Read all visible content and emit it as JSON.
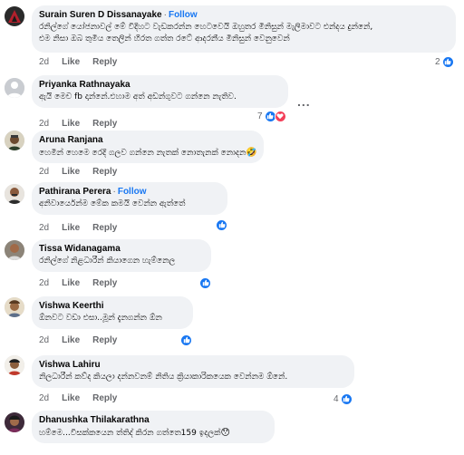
{
  "comments": [
    {
      "author": "Surain Suren D Dissanayake",
      "follow": "Follow",
      "lines": [
        "රනිල්ගේ යෝජනාවල් මේ විදිහට වැඩකරන්න හෙටවෙයි ඔහුතර මිනිසුන් මැලිමාවට එන්දය දුන්නේ,",
        "එම නිසා ඔබ තුමිය තෙලින් හිරත ගත්ත රටේ ආදරනීය මිනිසුන් වෙනුවෙන්"
      ],
      "time": "2d",
      "like": "Like",
      "reply": "Reply",
      "reaction_count": "2"
    },
    {
      "author": "Priyanka Rathnayaka",
      "lines": [
        "ඇයි මෙච fb දාන්නේ.එහාම අත් අඩන්ගුවට ගන්නෙ නැතිව."
      ],
      "time": "2d",
      "like": "Like",
      "reply": "Reply",
      "reaction_count": "7",
      "more": "..."
    },
    {
      "author": "Aruna Ranjana",
      "lines": [
        "හෙමින් හෙමෙ රෙදි ගලව ගන්නෙ නැතක් නොතැනක් නොදන"
      ],
      "emoji": "🤣",
      "time": "2d",
      "like": "Like",
      "reply": "Reply"
    },
    {
      "author": "Pathirana Perera",
      "follow": "Follow",
      "lines": [
        "අනිවාර්යෙන්ම මේක කමයි වෙන්න ඇත්තේ"
      ],
      "time": "2d",
      "like": "Like",
      "reply": "Reply"
    },
    {
      "author": "Tissa Widanagama",
      "lines": [
        "රනිල්ගේ නිළධාරීන් කියාගෙන හැම්නෙල"
      ],
      "time": "2d",
      "like": "Like",
      "reply": "Reply"
    },
    {
      "author": "Vishwa Keerthi",
      "lines": [
        "ඕනවට වඩා එසා..මූන් දැනගන්න ඕන"
      ],
      "time": "2d",
      "like": "Like",
      "reply": "Reply"
    },
    {
      "author": "Vishwa Lahiru",
      "lines": [
        "නිලධාරීන් කව්ද කියලා දන්නවනම් නිතිය ක්‍රියාකාරිකයෙක වෙන්නම ඕනේ."
      ],
      "time": "2d",
      "like": "Like",
      "reply": "Reply",
      "reaction_count": "4"
    },
    {
      "author": "Dhanushka Thilakarathna",
      "lines": [
        "හම්මෙ...විසක්කයෙන ත්තිද් කිරන ගත්තෙ159 ඉදලක්"
      ],
      "emoji": "😯",
      "time": "",
      "like": "",
      "reply": ""
    }
  ],
  "colors": {
    "accent": "#1877f2",
    "bubble": "#f0f2f5",
    "muted": "#65676b",
    "heart": "#f33e58"
  },
  "icons": {
    "like": "like-icon",
    "heart": "heart-icon"
  }
}
